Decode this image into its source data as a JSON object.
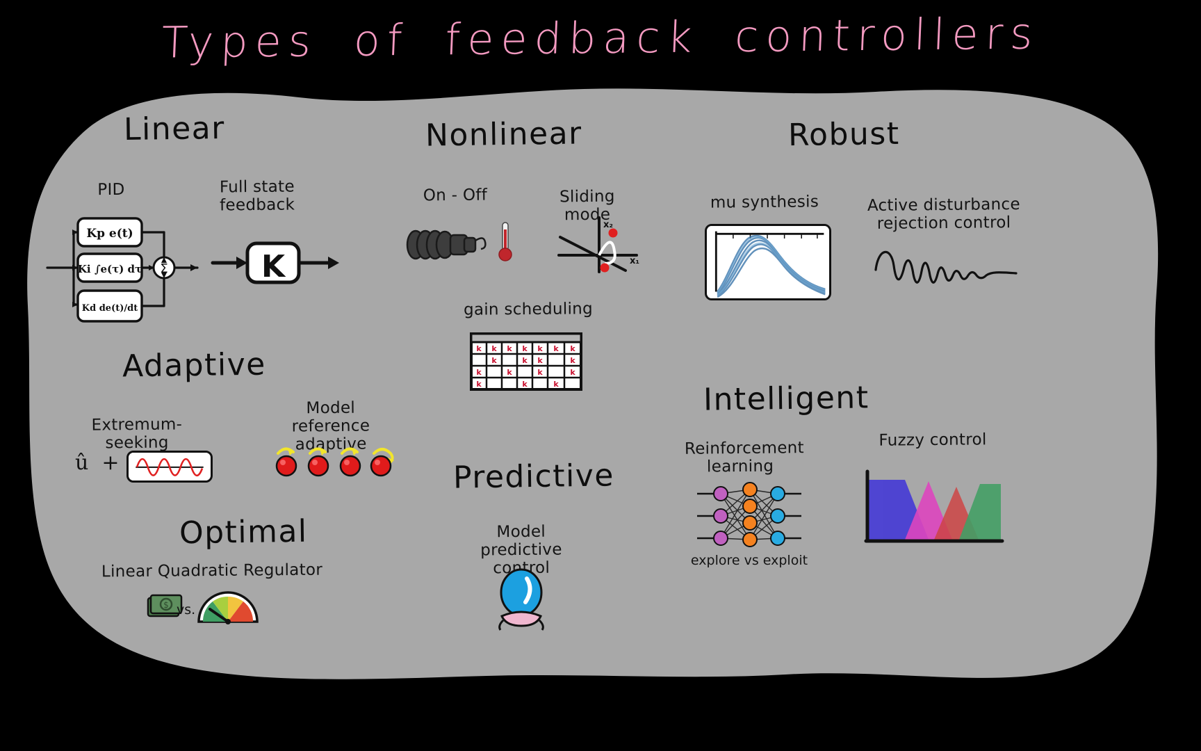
{
  "page": {
    "title": "Types  of  feedback  controllers",
    "background_color": "#000000",
    "blob_color": "#a8a8a8",
    "title_color": "#f49ac1",
    "ink_color": "#111111"
  },
  "categories": [
    {
      "id": "linear",
      "label": "Linear"
    },
    {
      "id": "nonlinear",
      "label": "Nonlinear"
    },
    {
      "id": "robust",
      "label": "Robust"
    },
    {
      "id": "adaptive",
      "label": "Adaptive"
    },
    {
      "id": "predictive",
      "label": "Predictive"
    },
    {
      "id": "optimal",
      "label": "Optimal"
    },
    {
      "id": "intelligent",
      "label": "Intelligent"
    }
  ],
  "items": {
    "pid": "PID",
    "full_state_feedback": "Full state\nfeedback",
    "on_off": "On - Off",
    "sliding_mode": "Sliding mode",
    "gain_scheduling": "gain scheduling",
    "mu_synthesis": "mu synthesis",
    "adrc": "Active disturbance\nrejection control",
    "extremum_seeking": "Extremum-seeking",
    "model_reference_adaptive": "Model reference\nadaptive",
    "lqr": "Linear Quadratic Regulator",
    "mpc": "Model predictive\ncontrol",
    "reinforcement_learning": "Reinforcement\nlearning",
    "explore_vs_exploit": "explore vs exploit",
    "fuzzy_control": "Fuzzy control"
  },
  "pid_diagram": {
    "block_p": "Kp e(t)",
    "block_i": "Ki ∫e(τ) dτ",
    "block_d": "Kd de(t)/dt",
    "sum_symbol": "Σ"
  },
  "full_state_feedback_diagram": {
    "gain_label": "K"
  },
  "sliding_mode_diagram": {
    "axis_x_label": "x₁",
    "axis_y_label": "x₂",
    "point_color": "#e02020"
  },
  "gain_schedule_table": {
    "cell_letter": "k",
    "cell_color": "#c8102e",
    "rows": 4,
    "cols": 7,
    "filled": [
      [
        1,
        1,
        1,
        1,
        1,
        1,
        1
      ],
      [
        0,
        1,
        0,
        1,
        1,
        0,
        1
      ],
      [
        1,
        0,
        1,
        0,
        1,
        0,
        1
      ],
      [
        1,
        0,
        0,
        1,
        0,
        1,
        0
      ]
    ]
  },
  "lqr_icons": {
    "vs_label": "vs."
  },
  "extremum_seeking_plot": {
    "curve_color": "#e02020"
  },
  "mu_synthesis_plot": {
    "curve_color": "#2e6da4"
  },
  "fuzzy_plot": {
    "colors": [
      "#4a3fd4",
      "#e040c0",
      "#d04040",
      "#3f9e63"
    ],
    "axis_color": "#111111"
  },
  "neural_net": {
    "input_color": "#c061c0",
    "hidden_color": "#f58220",
    "output_color": "#29abe2",
    "input_nodes": 3,
    "hidden_nodes": 4,
    "output_nodes": 3
  },
  "mra_balls": {
    "ball_color": "#e01b1b",
    "arrow_color": "#f2e52b",
    "count": 4
  },
  "adrc_wave": {
    "color": "#111111"
  },
  "thermometer": {
    "color": "#c0262c"
  },
  "crystal_ball": {
    "globe_color": "#1ca0e0",
    "base_color": "#f0b7cf"
  }
}
